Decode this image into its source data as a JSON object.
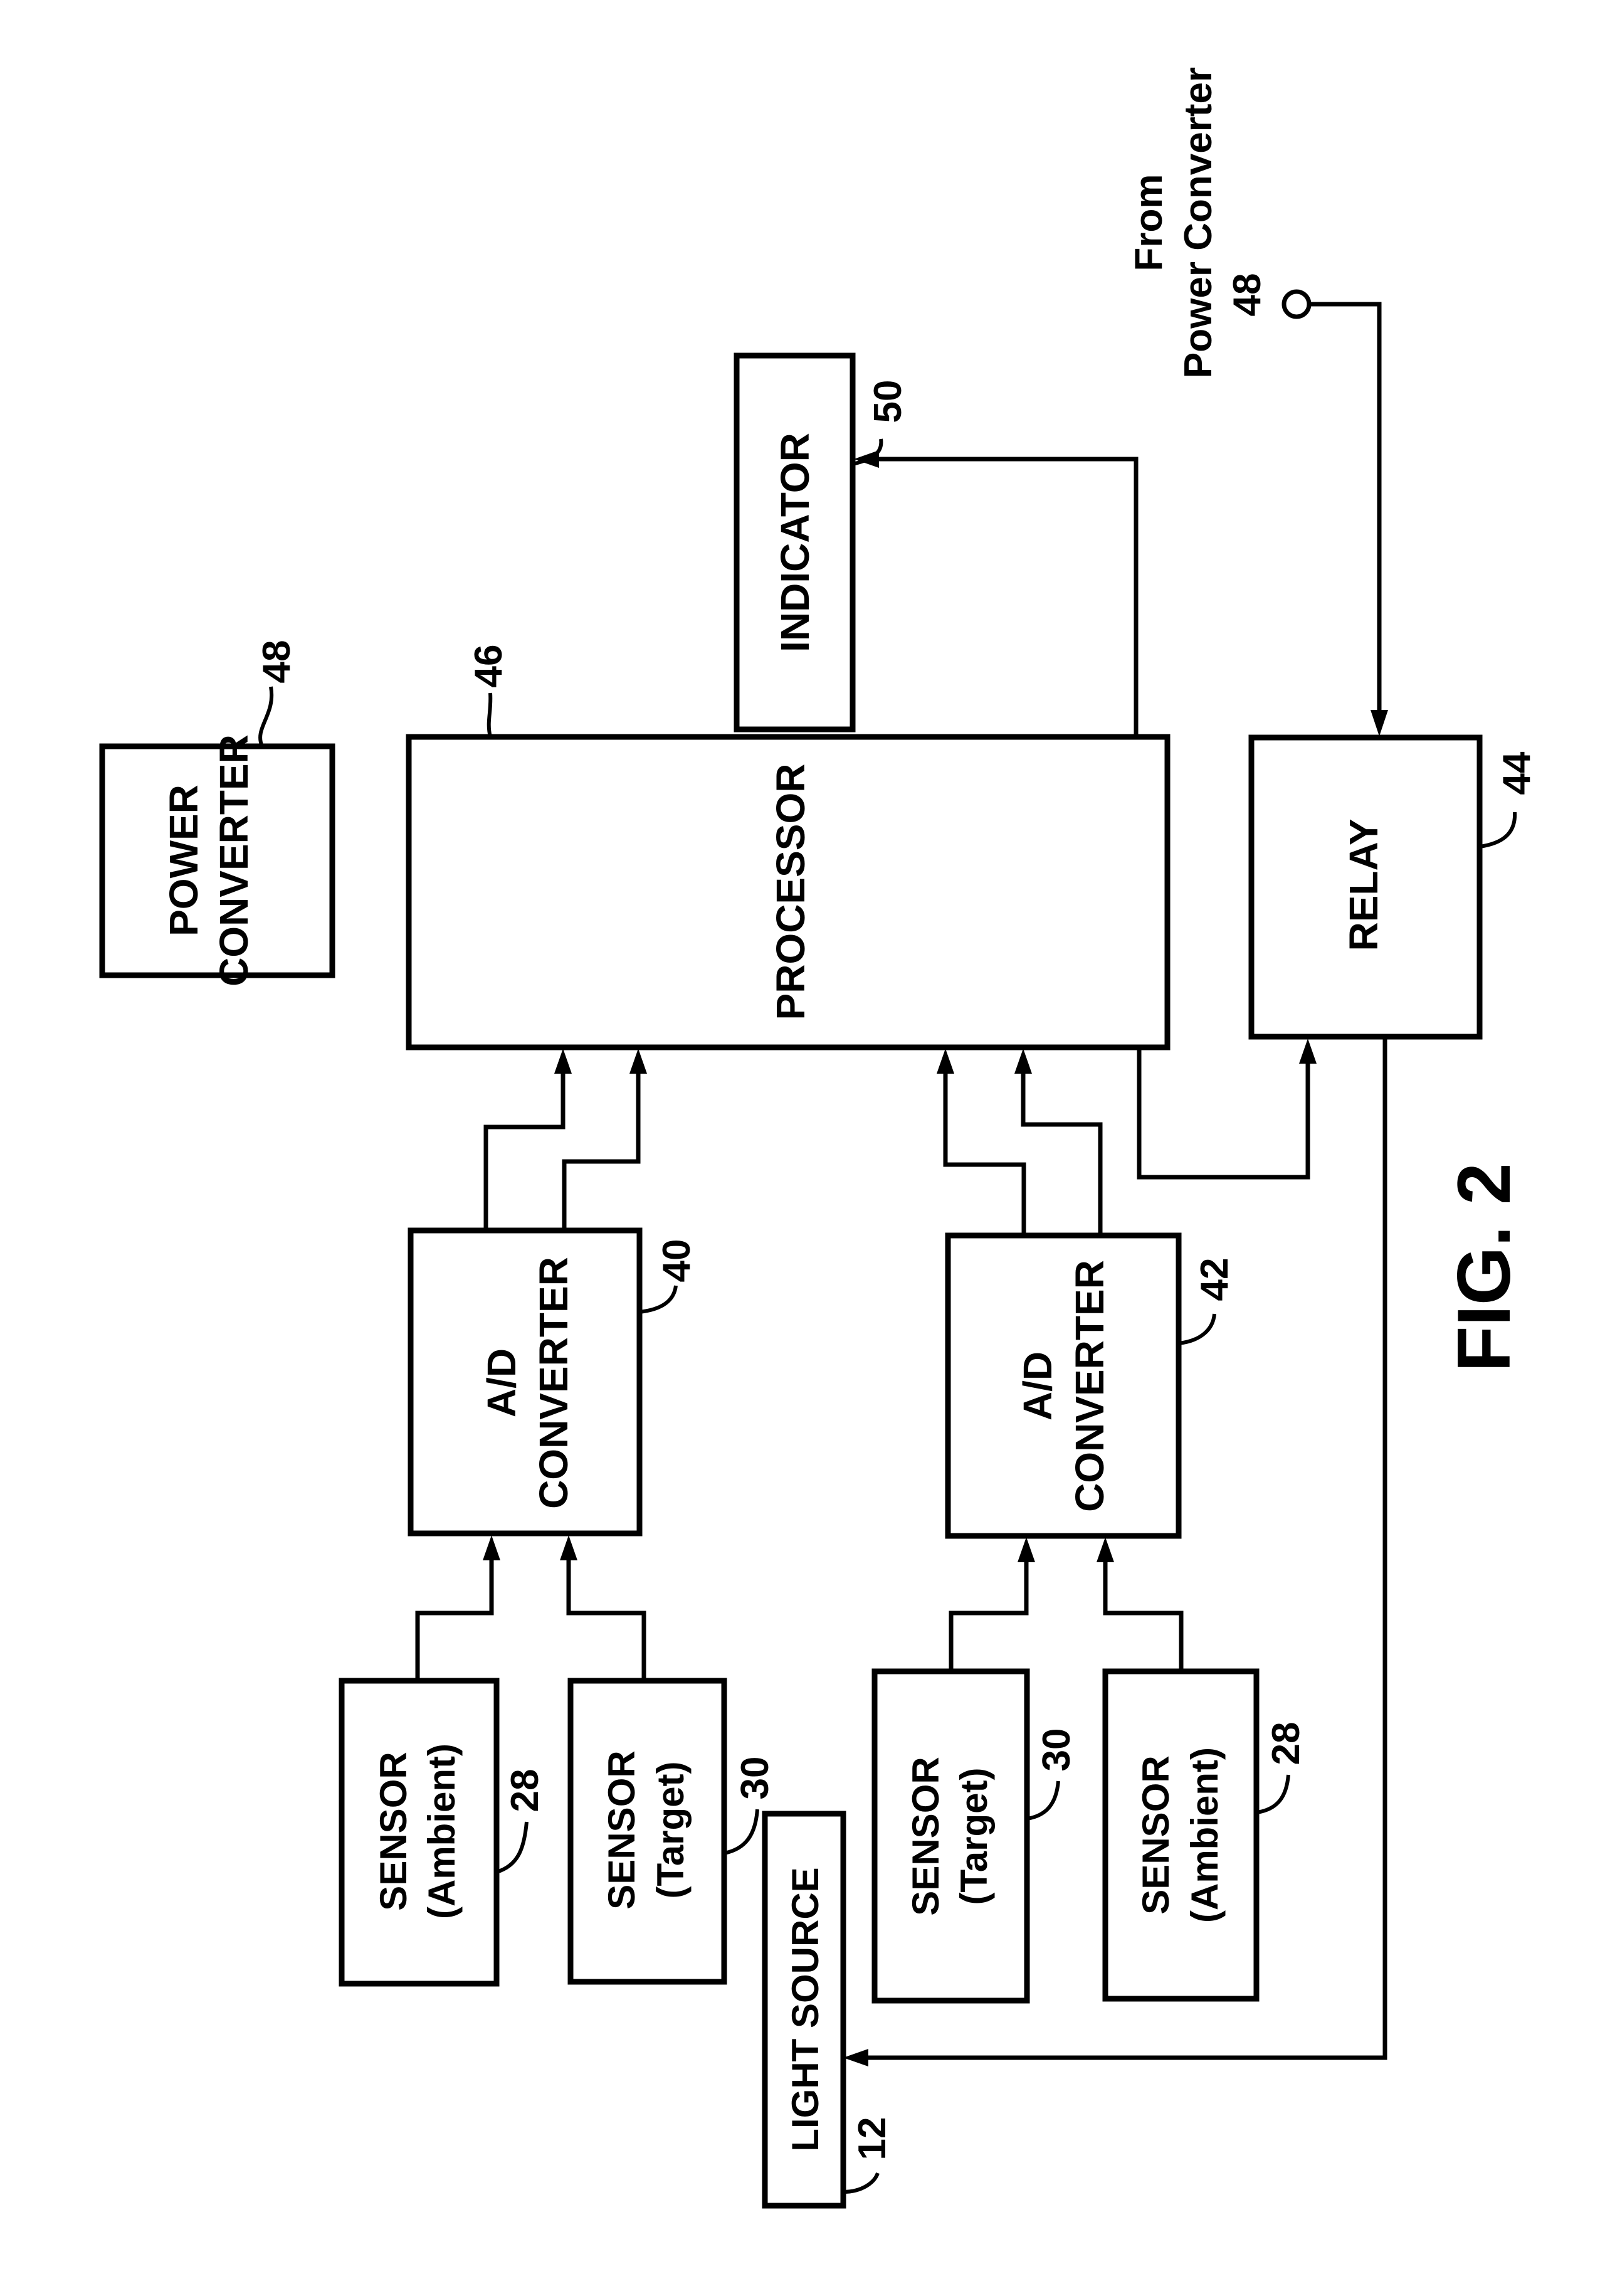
{
  "figure": {
    "caption": "FIG. 2",
    "blocks": {
      "power_converter": {
        "line1": "POWER",
        "line2": "CONVERTER",
        "ref": "48"
      },
      "processor": {
        "label": "PROCESSOR",
        "ref": "46"
      },
      "indicator": {
        "label": "INDICATOR",
        "ref": "50"
      },
      "relay": {
        "label": "RELAY",
        "ref": "44"
      },
      "ad_converter_1": {
        "line1": "A/D",
        "line2": "CONVERTER",
        "ref": "40"
      },
      "ad_converter_2": {
        "line1": "A/D",
        "line2": "CONVERTER",
        "ref": "42"
      },
      "sensor_ambient_1": {
        "line1": "SENSOR",
        "line2": "(Ambient)",
        "ref": "28"
      },
      "sensor_target_1": {
        "line1": "SENSOR",
        "line2": "(Target)",
        "ref": "30"
      },
      "sensor_target_2": {
        "line1": "SENSOR",
        "line2": "(Target)",
        "ref": "30"
      },
      "sensor_ambient_2": {
        "line1": "SENSOR",
        "line2": "(Ambient)",
        "ref": "28"
      },
      "light_source": {
        "label": "LIGHT SOURCE",
        "ref": "12"
      }
    },
    "external_input": {
      "line1": "From",
      "line2": "Power Converter",
      "line3": "48"
    }
  }
}
